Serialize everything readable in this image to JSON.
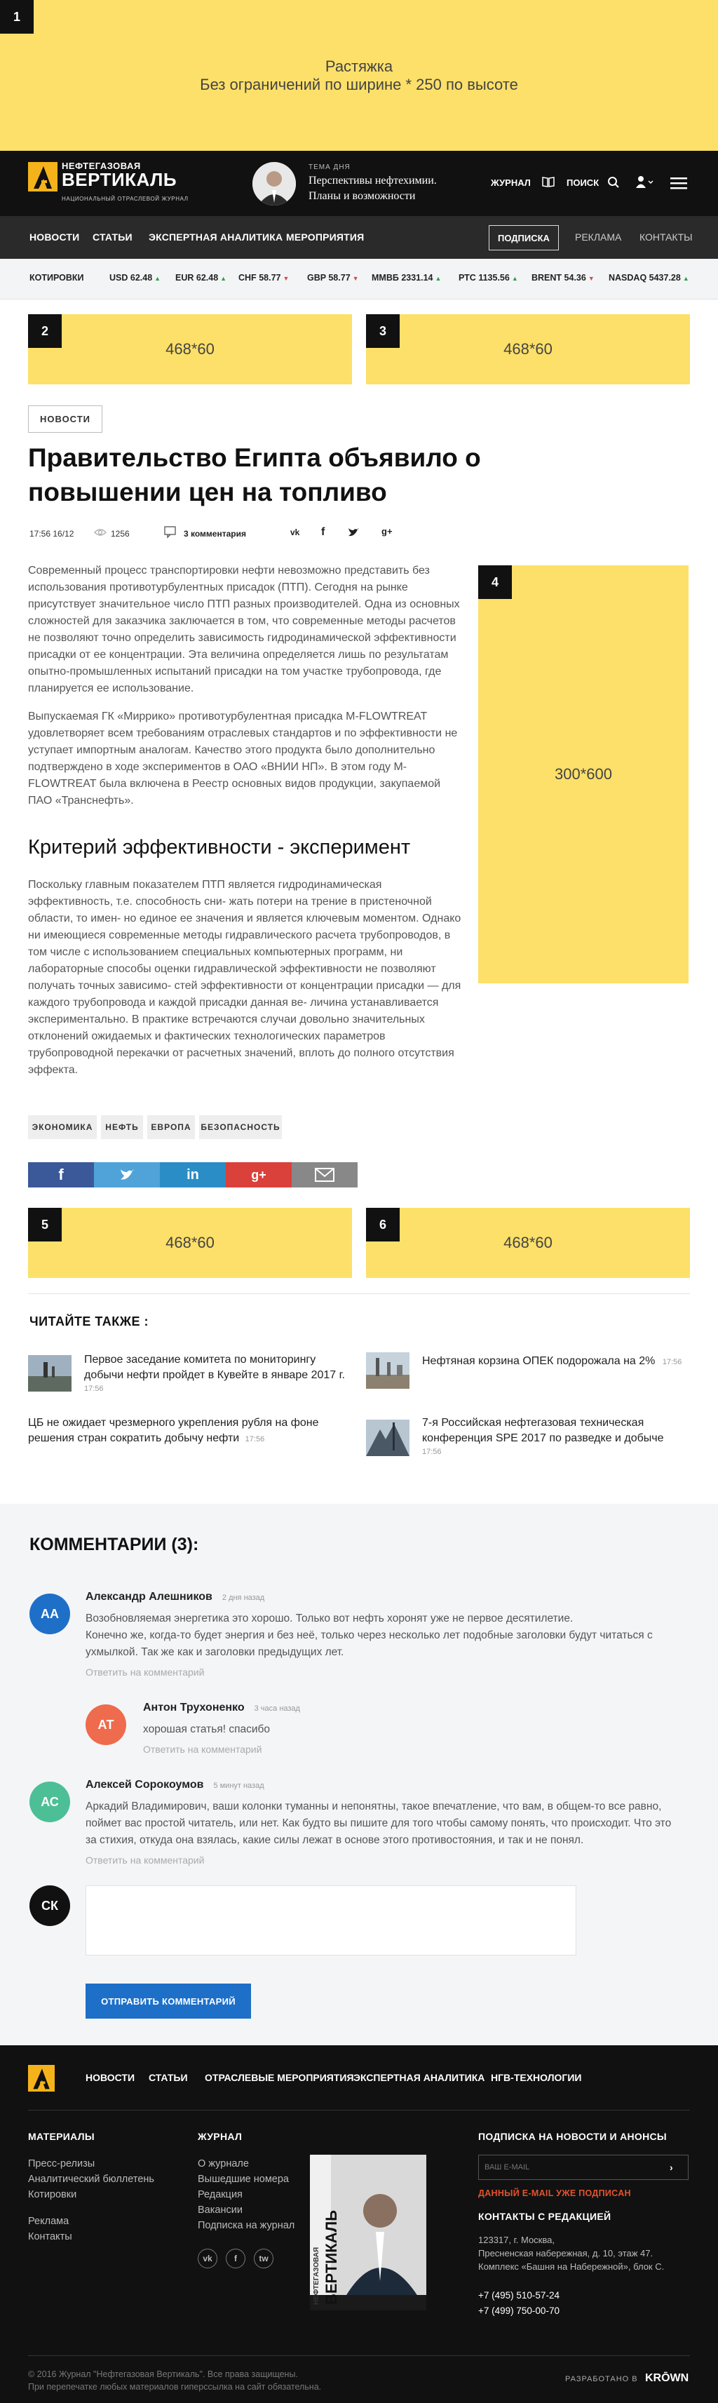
{
  "top_ad": {
    "number": "1",
    "line1": "Растяжка",
    "line2": "Без ограничений по ширине * 250 по высоте"
  },
  "header": {
    "logo_top": "НЕФТЕГАЗОВАЯ",
    "logo_main": "ВЕРТИКАЛЬ",
    "logo_sub": "НАЦИОНАЛЬНЫЙ ОТРАСЛЕВОЙ ЖУРНАЛ",
    "theme_label": "ТЕМА ДНЯ",
    "theme_title": "Перспективы нефтехимии. Планы и возможности",
    "journal": "ЖУРНАЛ",
    "search": "ПОИСК"
  },
  "nav": {
    "items": [
      "НОВОСТИ",
      "СТАТЬИ",
      "ЭКСПЕРТНАЯ АНАЛИТИКА",
      "МЕРОПРИЯТИЯ"
    ],
    "subscribe": "ПОДПИСКА",
    "ads": "РЕКЛАМА",
    "contacts": "КОНТАКТЫ"
  },
  "quotes": {
    "label": "КОТИРОВКИ",
    "items": [
      {
        "name": "USD",
        "value": "62.48",
        "dir": "up"
      },
      {
        "name": "EUR",
        "value": "62.48",
        "dir": "up"
      },
      {
        "name": "CHF",
        "value": "58.77",
        "dir": "dn"
      },
      {
        "name": "GBP",
        "value": "58.77",
        "dir": "dn"
      },
      {
        "name": "ММВБ",
        "value": "2331.14",
        "dir": "up"
      },
      {
        "name": "РТС",
        "value": "1135.56",
        "dir": "up"
      },
      {
        "name": "BRENT",
        "value": "54.36",
        "dir": "dn"
      },
      {
        "name": "NASDAQ",
        "value": "5437.28",
        "dir": "up"
      }
    ],
    "up_arrow": "▲",
    "down_arrow": "▼"
  },
  "ads": {
    "a2": {
      "number": "2",
      "size": "468*60"
    },
    "a3": {
      "number": "3",
      "size": "468*60"
    },
    "a4": {
      "number": "4",
      "size": "300*600"
    },
    "a5": {
      "number": "5",
      "size": "468*60"
    },
    "a6": {
      "number": "6",
      "size": "468*60"
    }
  },
  "article": {
    "category": "НОВОСТИ",
    "title": "Правительство Египта объявило о повышении цен на топливо",
    "date": "17:56 16/12",
    "views": "1256",
    "comments": "3 комментария",
    "share_labels": [
      "vk",
      "f",
      "tw",
      "g+"
    ],
    "p1": "Современный процесс транспортировки нефти невозможно представить без использования противотурбулентных присадок (ПТП). Сегодня на рынке присутствует значительное число ПТП разных производителей. Одна из основных сложностей для заказчика заключается в том, что современные методы расчетов не позволяют точно определить зависимость гидродинамической эффективности присадки от ее концентрации. Эта величина определяется лишь по результатам опытно-промышленных испытаний присадки на том участке трубопровода, где планируется ее использование.",
    "p2": "Выпускаемая ГК «Миррико» противотурбулентная присадка M-FLOWTREAT удовлетворяет всем требованиям отраслевых стандартов и по эффективности не уступает импортным аналогам. Качество этого продукта было дополнительно подтверждено в ходе экспериментов в ОАО «ВНИИ НП». В этом году M-FLOWTREAT была включена в Реестр основных видов продукции, закупаемой ПАО «Транснефть».",
    "h2": "Критерий эффективности - эксперимент",
    "p3": "Поскольку главным показателем ПТП является гидродинамическая эффективность, т.е. способность сни- жать потери на трение в пристеночной области, то имен- но единое ее значения и является ключевым моментом. Однако ни имеющиеся современные методы гидравлического расчета трубопроводов, в том числе с использованием специальных компьютерных программ, ни лабораторные способы оценки гидравлической эффективности не позволяют получать точных зависимо- стей эффективности от концентрации присадки — для каждого трубопровода и каждой присадки данная ве- личина устанавливается экспериментально. В практике встречаются случаи довольно значительных отклонений ожидаемых и фактических технологических параметров трубопроводной перекачки от расчетных значений, вплоть до полного отсутствия эффекта.",
    "tags": [
      "ЭКОНОМИКА",
      "НЕФТЬ",
      "ЕВРОПА",
      "БЕЗОПАСНОСТЬ"
    ]
  },
  "related": {
    "heading": "ЧИТАЙТЕ ТАКЖЕ :",
    "items": [
      {
        "title": "Первое заседание комитета по мониторингу добычи нефти пройдет в Кувейте в январе 2017 г.",
        "time": "17:56"
      },
      {
        "title": "Нефтяная корзина ОПЕК подорожала на 2%",
        "time": "17:56"
      },
      {
        "title": "ЦБ не ожидает чрезмерного укрепления рубля на фоне решения стран сократить добычу нефти",
        "time": "17:56"
      },
      {
        "title": "7-я Российская нефтегазовая техническая конференция SPE 2017 по разведке и добыче",
        "time": "17:56"
      }
    ]
  },
  "comments": {
    "heading": "КОММЕНТАРИИ (3):",
    "reply_label": "Ответить на комментарий",
    "items": [
      {
        "initials": "АА",
        "name": "Александр Алешников",
        "date": "2 дня назад",
        "text1": "Возобновляемая энергетика это хорошо. Только вот нефть хоронят уже не первое десятилетие.",
        "text2": "Конечно же, когда-то будет энергия и без неё, только через несколько лет подобные заголовки будут читаться с ухмылкой. Так же как и заголовки предыдущих лет."
      },
      {
        "initials": "АТ",
        "name": "Антон Трухоненко",
        "date": "3 часа назад",
        "text1": "хорошая статья! спасибо",
        "text2": ""
      },
      {
        "initials": "АС",
        "name": "Алексей Сорокоумов",
        "date": "5 минут назад",
        "text1": "Аркадий Владимирович, ваши колонки туманны и непонятны, такое впечатление, что вам, в общем-то все равно, поймет вас простой читатель, или нет. Как будто вы пишите для того чтобы самому понять, что происходит. Что это за стихия, откуда она взялась, какие силы лежат в основе этого противостояния, и так и не понял.",
        "text2": ""
      }
    ],
    "current_user": "СК",
    "submit": "ОТПРАВИТЬ КОММЕНТАРИЙ"
  },
  "footer": {
    "nav": [
      "НОВОСТИ",
      "СТАТЬИ",
      "ОТРАСЛЕВЫЕ МЕРОПРИЯТИЯ",
      "ЭКСПЕРТНАЯ АНАЛИТИКА",
      "НГВ-ТЕХНОЛОГИИ"
    ],
    "materials_heading": "МАТЕРИАЛЫ",
    "materials": [
      "Пресс-релизы",
      "Аналитический бюллетень",
      "Котировки"
    ],
    "materials2": [
      "Реклама",
      "Контакты"
    ],
    "journal_heading": "ЖУРНАЛ",
    "journal": [
      "О журнале",
      "Вышедшие номера",
      "Редакция",
      "Вакансии",
      "Подписка на журнал"
    ],
    "socials": [
      "vk",
      "f",
      "tw"
    ],
    "cover_top": "НЕФТЕГАЗОВАЯ",
    "cover_main": "ВЕРТИКАЛЬ",
    "subscribe_heading": "ПОДПИСКА НА НОВОСТИ И АНОНСЫ",
    "email_placeholder": "ВАШ E-MAIL",
    "email_status": "ДАННЫЙ E-MAIL УЖЕ ПОДПИСАН",
    "contacts_heading": "КОНТАКТЫ С РЕДАКЦИЕЙ",
    "address": [
      "123317, г. Москва,",
      "Пресненская набережная, д. 10, этаж 47.",
      "Комплекс «Башня на Набережной», блок С."
    ],
    "phones": [
      "+7 (495) 510-57-24",
      "+7 (499) 750-00-70"
    ],
    "copyright1": "© 2016 Журнал \"Нефтегазовая Вертикаль\". Все права защищены.",
    "copyright2": "При перепечатке любых материалов гиперссылка на сайт обязательна.",
    "developed": "РАЗРАБОТАНО В",
    "developer": "KRŌWN"
  },
  "colors": {
    "accent": "#fde069",
    "logo": "#f5b31b",
    "button": "#1e6fc8",
    "av1": "#1e6fc8",
    "av2": "#ee6b4d",
    "av3": "#4cbf97",
    "av4": "#111111",
    "fb": "#3b5998",
    "tw": "#4fa3d8",
    "li": "#2b8dc5",
    "gp": "#d9413a",
    "mail": "#888888"
  }
}
